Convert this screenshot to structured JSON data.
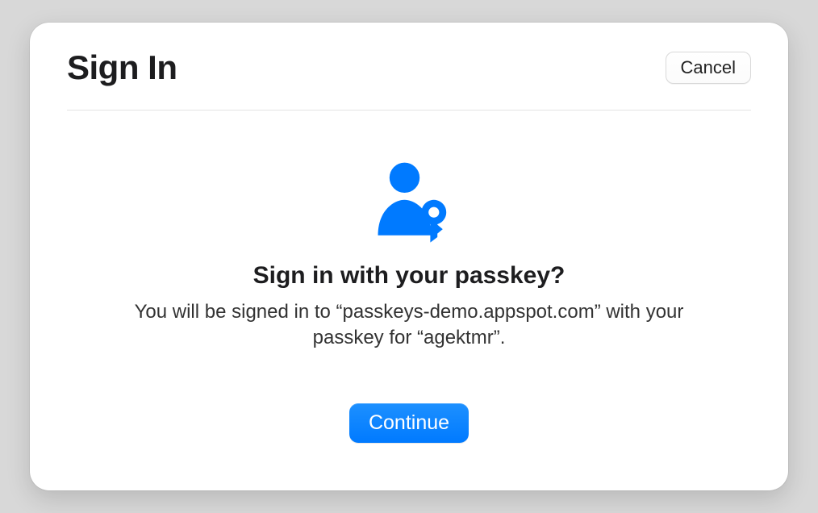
{
  "header": {
    "title": "Sign In",
    "cancel_label": "Cancel"
  },
  "body": {
    "title": "Sign in with your passkey?",
    "message": "You will be signed in to “passkeys-demo.appspot.com” with your passkey for “agektmr”.",
    "continue_label": "Continue"
  },
  "icon": {
    "name": "person-key-icon",
    "color": "#007aff"
  }
}
